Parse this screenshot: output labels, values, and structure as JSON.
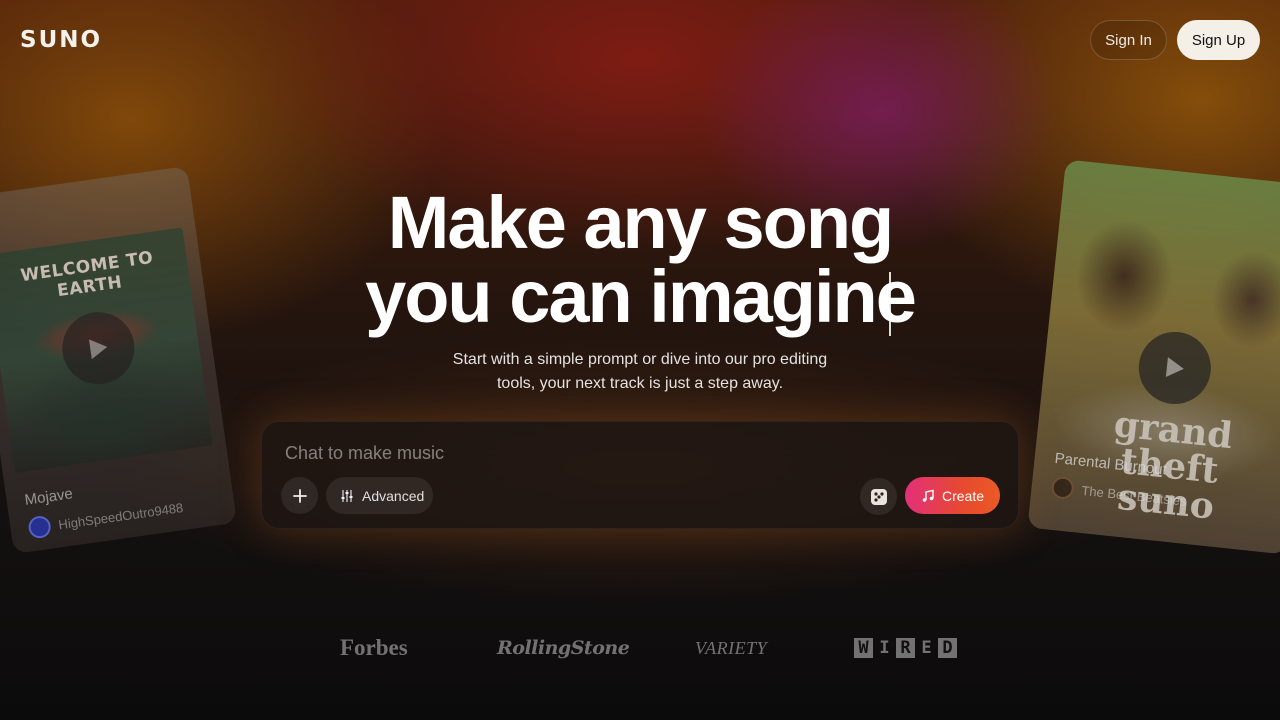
{
  "brand": {
    "logo": "SUNO"
  },
  "header": {
    "sign_in": "Sign In",
    "sign_up": "Sign Up"
  },
  "hero": {
    "title_line1": "Make any song",
    "title_line2": "you can imagine",
    "subtitle_line1": "Start with a simple prompt or dive into our pro editing",
    "subtitle_line2": "tools, your next track is just a step away."
  },
  "prompt": {
    "placeholder": "Chat to make music",
    "advanced_label": "Advanced",
    "create_label": "Create",
    "icons": [
      "plus-icon",
      "sliders-icon",
      "dice-icon",
      "music-note-icon"
    ]
  },
  "cards": {
    "left": {
      "art_text": "WELCOME TO EARTH",
      "title": "Mojave",
      "artist": "HighSpeedOutro9488"
    },
    "right": {
      "art_text": "grand theft suno",
      "title": "Parental Burnout",
      "artist": "The Best Beatsies"
    }
  },
  "press": {
    "forbes": "Forbes",
    "rolling_stone": "RollingStone",
    "variety": "VARIETY",
    "wired": [
      "W",
      "I",
      "R",
      "E",
      "D"
    ]
  },
  "colors": {
    "create_gradient_start": "#e2307a",
    "create_gradient_end": "#ea5a25",
    "signup_bg": "#f4f0e7"
  }
}
